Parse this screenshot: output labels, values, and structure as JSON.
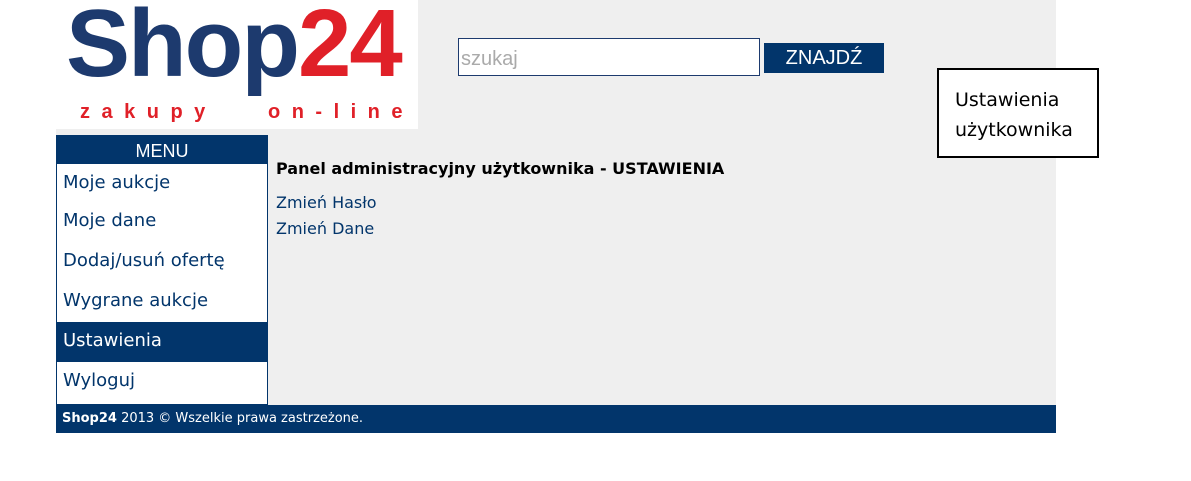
{
  "logo": {
    "name_part1": "Shop",
    "name_part2": "24",
    "tagline": "zakupy   on-line",
    "colors": {
      "brand_blue": "#1d3a6e",
      "brand_red": "#e02028"
    }
  },
  "search": {
    "placeholder": "szukaj",
    "value": "",
    "button_label": "ZNAJDŹ"
  },
  "tooltip": {
    "text": "Ustawienia użytkownika"
  },
  "menu": {
    "header": "MENU",
    "items": [
      {
        "label": "Moje aukcje",
        "active": false
      },
      {
        "label": "Moje dane",
        "active": false
      },
      {
        "label": "Dodaj/usuń ofertę",
        "active": false
      },
      {
        "label": "Wygrane aukcje",
        "active": false
      },
      {
        "label": "Ustawienia",
        "active": true
      },
      {
        "label": "Wyloguj",
        "active": false
      }
    ]
  },
  "content": {
    "title": "Panel administracyjny użytkownika - USTAWIENIA",
    "links": [
      {
        "label": "Zmień Hasło"
      },
      {
        "label": "Zmień Dane"
      }
    ]
  },
  "footer": {
    "brand": "Shop24",
    "text": " 2013 © Wszelkie prawa zastrzeżone."
  },
  "colors": {
    "accent": "#02356b",
    "page_bg": "#efefef"
  }
}
